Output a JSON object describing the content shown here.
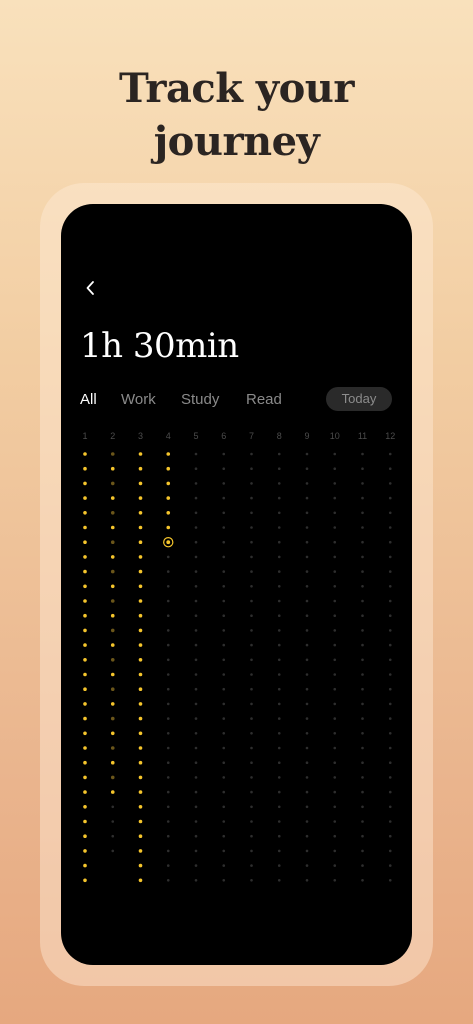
{
  "headline": {
    "line1": "Track your",
    "line2": "journey"
  },
  "app": {
    "duration": "1h 30min",
    "tabs": [
      "All",
      "Work",
      "Study",
      "Read"
    ],
    "active_tab": "All",
    "today_label": "Today",
    "columns": [
      "1",
      "2",
      "3",
      "4",
      "5",
      "6",
      "7",
      "8",
      "9",
      "10",
      "11",
      "12"
    ],
    "column_lengths": [
      30,
      28,
      30,
      30,
      30,
      30,
      30,
      30,
      30,
      30,
      30,
      30
    ],
    "filled_dots_per_column": [
      30,
      24,
      30,
      7,
      0,
      0,
      0,
      0,
      0,
      0,
      0,
      0
    ],
    "current_dot": {
      "column": 4,
      "row": 7
    },
    "colors": {
      "filled": "#f5c52c",
      "filled_dim": "#6b561a",
      "empty": "#2e2e2e",
      "background": "#000000"
    }
  }
}
